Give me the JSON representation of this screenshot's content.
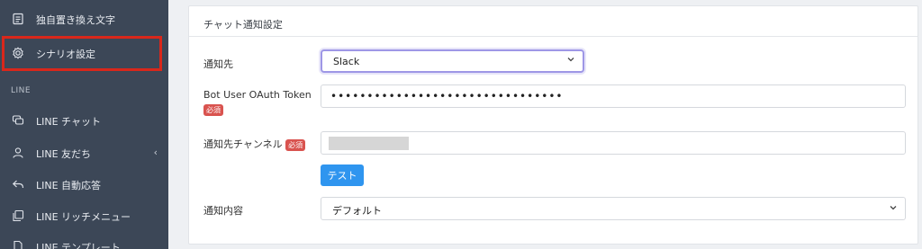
{
  "sidebar": {
    "items": [
      {
        "label": "独自置き換え文字",
        "icon": "document-icon"
      },
      {
        "label": "シナリオ設定",
        "icon": "gear-icon"
      },
      {
        "label": "LINE チャット",
        "icon": "chat-icon"
      },
      {
        "label": "LINE 友だち",
        "icon": "user-icon",
        "chevron": "‹"
      },
      {
        "label": "LINE 自動応答",
        "icon": "reply-icon"
      },
      {
        "label": "LINE リッチメニュー",
        "icon": "copy-icon"
      },
      {
        "label": "LINE テンプレート",
        "icon": "file-icon"
      }
    ],
    "section_label": "LINE"
  },
  "card": {
    "title": "チャット通知設定",
    "notify_target_label": "通知先",
    "notify_target_value": "Slack",
    "token_label": "Bot User OAuth Token",
    "required_badge": "必須",
    "token_value": "••••••••••••••••••••••••••••••••",
    "channel_label": "通知先チャンネル",
    "test_button": "テスト",
    "content_label": "通知内容",
    "content_value": "デフォルト"
  },
  "colors": {
    "sidebar_bg": "#3c4757",
    "highlight_border": "#d9271b",
    "button_bg": "#2f95ef",
    "required_bg": "#d9534f",
    "focus_border": "#9e97e6"
  }
}
